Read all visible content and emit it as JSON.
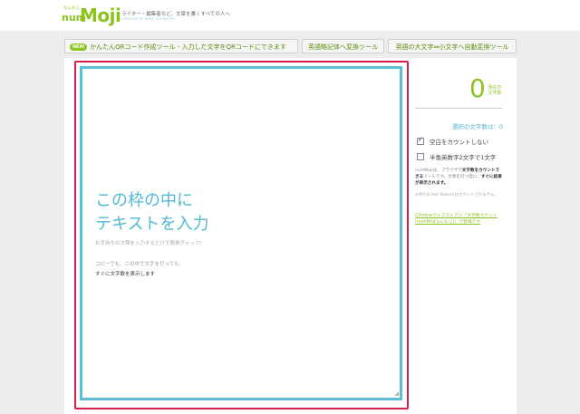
{
  "header": {
    "logo_small": "なんもじ",
    "logo_num": "num",
    "logo_moji": "Moji",
    "tagline": "ライター・編集者など、文章を書くすべての人へ",
    "credit": "CREATED BY KENJI SUGIMOTO"
  },
  "nav": {
    "qr_badge": "NEW",
    "qr_label": "かんたんQRコード作成ツール - 入力した文字をQRコードにできます",
    "eiyaku_label": "英語略記体へ変換ツール",
    "case_label": "英語の大文字⇔小文字へ自動変換ツール"
  },
  "editor": {
    "placeholder_line1": "この枠の中に",
    "placeholder_line2": "テキストを入力",
    "placeholder_sub": "お手持ちの文章を入力するだけで簡単チェック!",
    "note_line1": "コピーでも、この中で文字を打っても、",
    "note_line2": "すぐに文字数を表示します",
    "resize_glyph": "◢"
  },
  "sidebar": {
    "count_value": "0",
    "count_label_line1": "現在の",
    "count_label_line2": "文字数",
    "selected_count": "選択の文字数は：0",
    "opt_space_label": "空白をカウントしない",
    "opt_space_checked": true,
    "opt_halfwidth_label": "半角英数字2文字で1文字",
    "opt_halfwidth_checked": false,
    "desc_part1": "numMojiは、ブラウザで",
    "desc_bold1": "文字数をカウントできる",
    "desc_part2": "ツールです。文章を打つ度に、",
    "desc_bold2": "すぐに結果が表示されます。",
    "newline_note": "※改行(Enter Return)はカウントされません。",
    "ext_link": "Chromeウェブストアに「文字数カウント(numMojiなんもじ)」が登場です"
  },
  "colors": {
    "accent_green": "#8cc320",
    "accent_blue": "#5bc0d7",
    "frame_red": "#d6204c"
  }
}
